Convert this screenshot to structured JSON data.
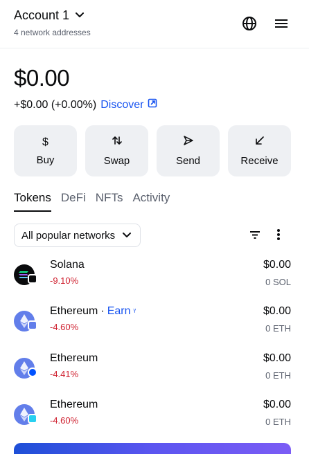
{
  "header": {
    "account_name": "Account 1",
    "network_addresses": "4 network addresses",
    "icons": [
      "chevron-down-icon",
      "globe-icon",
      "menu-icon"
    ]
  },
  "balance": {
    "total": "$0.00",
    "change": "+$0.00 (+0.00%)",
    "discover_label": "Discover"
  },
  "actions": [
    {
      "label": "Buy",
      "icon": "dollar-icon",
      "glyph": "$"
    },
    {
      "label": "Swap",
      "icon": "swap-icon",
      "glyph": "⇅"
    },
    {
      "label": "Send",
      "icon": "send-icon",
      "glyph": "▷"
    },
    {
      "label": "Receive",
      "icon": "receive-icon",
      "glyph": "↙"
    }
  ],
  "tabs": [
    {
      "label": "Tokens",
      "active": true
    },
    {
      "label": "DeFi",
      "active": false
    },
    {
      "label": "NFTs",
      "active": false
    },
    {
      "label": "Activity",
      "active": false
    }
  ],
  "filter": {
    "network_select": "All popular networks"
  },
  "tokens": [
    {
      "name": "Solana",
      "earn": "",
      "change": "-9.10%",
      "value": "$0.00",
      "amount": "0 SOL"
    },
    {
      "name": "Ethereum",
      "earn": "Earn",
      "change": "-4.60%",
      "value": "$0.00",
      "amount": "0 ETH"
    },
    {
      "name": "Ethereum",
      "earn": "",
      "change": "-4.41%",
      "value": "$0.00",
      "amount": "0 ETH"
    },
    {
      "name": "Ethereum",
      "earn": "",
      "change": "-4.60%",
      "value": "$0.00",
      "amount": "0 ETH"
    }
  ],
  "colors": {
    "accent": "#1652f0",
    "negative": "#cf202f",
    "muted": "#5b616e",
    "action_bg": "#eef0f3"
  }
}
